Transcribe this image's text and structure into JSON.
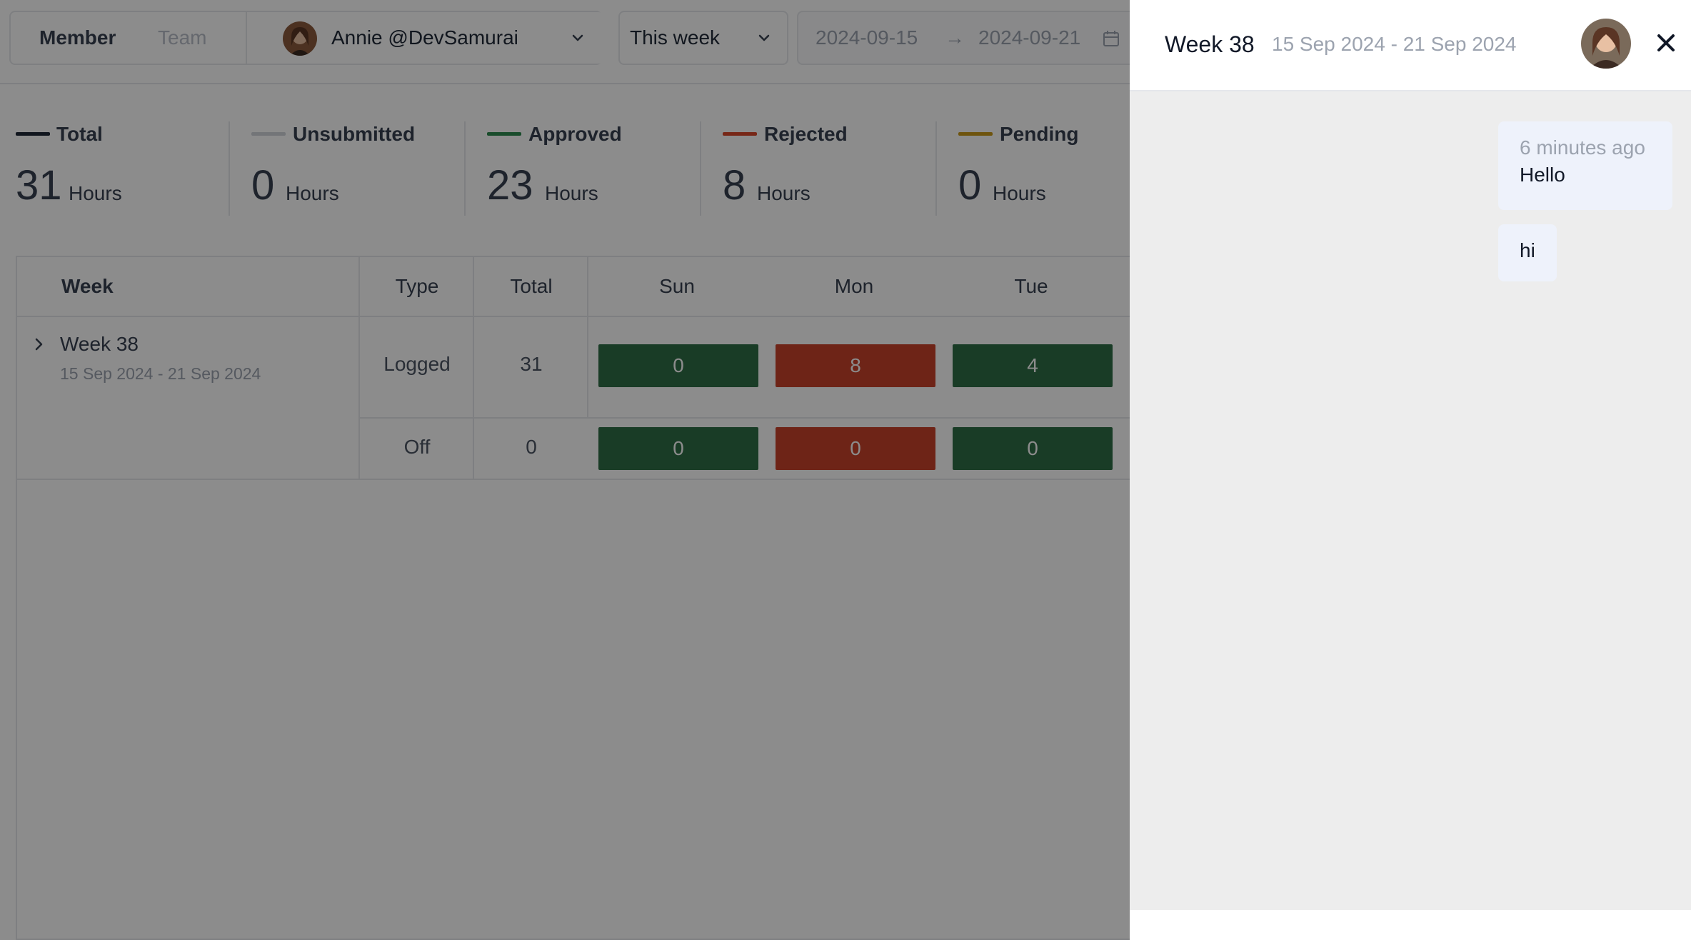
{
  "toolbar": {
    "mode_member": "Member",
    "mode_team": "Team",
    "user": "Annie @DevSamurai",
    "period": "This week",
    "date_from": "2024-09-15",
    "date_arrow": "→",
    "date_to": "2024-09-21"
  },
  "stats": [
    {
      "label": "Total",
      "value": "31",
      "unit": "Hours",
      "color": "#1f2937"
    },
    {
      "label": "Unsubmitted",
      "value": "0",
      "unit": "Hours",
      "color": "#d1d5db"
    },
    {
      "label": "Approved",
      "value": "23",
      "unit": "Hours",
      "color": "#2f8a4f"
    },
    {
      "label": "Rejected",
      "value": "8",
      "unit": "Hours",
      "color": "#d9482b"
    },
    {
      "label": "Pending",
      "value": "0",
      "unit": "Hours",
      "color": "#c99a1a"
    }
  ],
  "table": {
    "headers": {
      "week": "Week",
      "type": "Type",
      "total": "Total",
      "sun": "Sun",
      "mon": "Mon",
      "tue": "Tue"
    },
    "week_label": "Week 38",
    "week_dates": "15 Sep 2024 - 21 Sep 2024",
    "rows": [
      {
        "type": "Logged",
        "total": "31",
        "sun": "0",
        "mon": "8",
        "tue": "4"
      },
      {
        "type": "Off",
        "total": "0",
        "sun": "0",
        "mon": "0",
        "tue": "0"
      }
    ]
  },
  "colors": {
    "approved": "#2f6e45",
    "rejected": "#c8432b"
  },
  "drawer": {
    "title": "Week 38",
    "range": "15 Sep 2024 - 21 Sep 2024",
    "messages": [
      {
        "time": "6 minutes ago",
        "text": "Hello"
      },
      {
        "time": "",
        "text": "hi"
      }
    ]
  }
}
